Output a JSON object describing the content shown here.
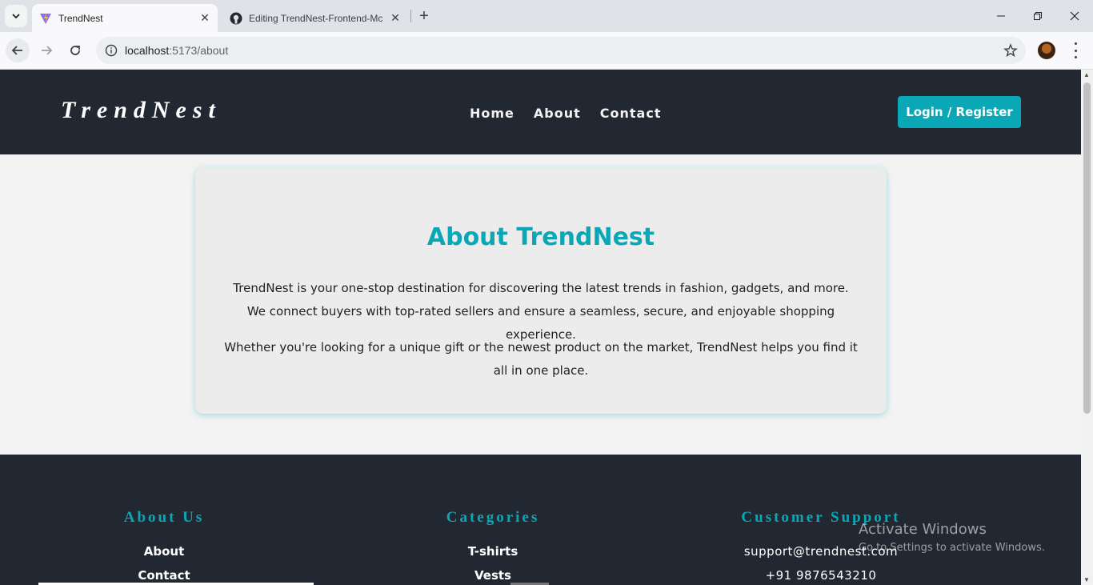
{
  "browser": {
    "tabs": [
      {
        "title": "TrendNest",
        "active": true,
        "icon": "vite-icon"
      },
      {
        "title": "Editing TrendNest-Frontend-Mc",
        "active": false,
        "icon": "github-icon"
      }
    ],
    "url_host": "localhost",
    "url_path": ":5173/about"
  },
  "header": {
    "logo": "TrendNest",
    "nav": [
      "Home",
      "About",
      "Contact"
    ],
    "login_label": "Login / Register"
  },
  "about": {
    "title": "About TrendNest",
    "paragraph1": "TrendNest is your one-stop destination for discovering the latest trends in fashion, gadgets, and more. We connect buyers with top-rated sellers and ensure a seamless, secure, and enjoyable shopping experience.",
    "paragraph2": "Whether you're looking for a unique gift or the newest product on the market, TrendNest helps you find it all in one place."
  },
  "footer": {
    "about_us": {
      "heading": "About Us",
      "links": [
        "About",
        "Contact"
      ]
    },
    "categories": {
      "heading": "Categories",
      "links": [
        "T-shirts",
        "Vests"
      ]
    },
    "support": {
      "heading": "Customer Support",
      "email": "support@trendnest.com",
      "phone": "+91 9876543210"
    }
  },
  "watermark": {
    "title": "Activate Windows",
    "subtitle": "Go to Settings to activate Windows."
  },
  "colors": {
    "accent": "#0aa8b6",
    "dark": "#222831",
    "page_bg": "#f3f3f3"
  }
}
